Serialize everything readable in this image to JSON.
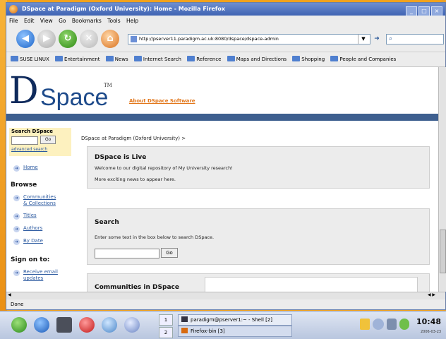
{
  "window": {
    "title": "DSpace at Paradigm (Oxford University): Home - Mozilla Firefox"
  },
  "menu": [
    "File",
    "Edit",
    "View",
    "Go",
    "Bookmarks",
    "Tools",
    "Help"
  ],
  "toolbar": {
    "url": "http://pserver11.paradigm.ac.uk:8080/dspace/dspace-admin"
  },
  "bookmarks": [
    "SUSE LINUX",
    "Entertainment",
    "News",
    "Internet Search",
    "Reference",
    "Maps and Directions",
    "Shopping",
    "People and Companies"
  ],
  "page": {
    "logo_letter": "D",
    "logo_rest": "Space",
    "logo_tm": "TM",
    "about_link": "About DSpace Software",
    "breadcrumb": "DSpace at Paradigm (Oxford University) >",
    "sidebar": {
      "search_heading": "Search DSpace",
      "go_label": "Go",
      "advanced_search": "advanced search",
      "home": "Home",
      "browse_heading": "Browse",
      "communities_line1": "Communities",
      "communities_line2": "& Collections",
      "titles": "Titles",
      "authors": "Authors",
      "by_date": "By Date",
      "sign_on_heading": "Sign on to:",
      "receive_line1": "Receive email",
      "receive_line2": "updates"
    },
    "live_box": {
      "title": "DSpace is Live",
      "line1": "Welcome to our digital repository of My University research!",
      "line2": "More exciting news to appear here."
    },
    "search_box": {
      "title": "Search",
      "text": "Enter some text in the box below to search DSpace.",
      "go_label": "Go"
    },
    "communities_box": {
      "title": "Communities in DSpace"
    }
  },
  "status": {
    "text": "Done"
  },
  "taskbar": {
    "pager": [
      "1",
      "2"
    ],
    "tasks": [
      "paradigm@pserver1:~ - Shell [2]",
      "Firefox-bin [3]"
    ],
    "clock": "10:48",
    "date": "2006-03-23"
  }
}
